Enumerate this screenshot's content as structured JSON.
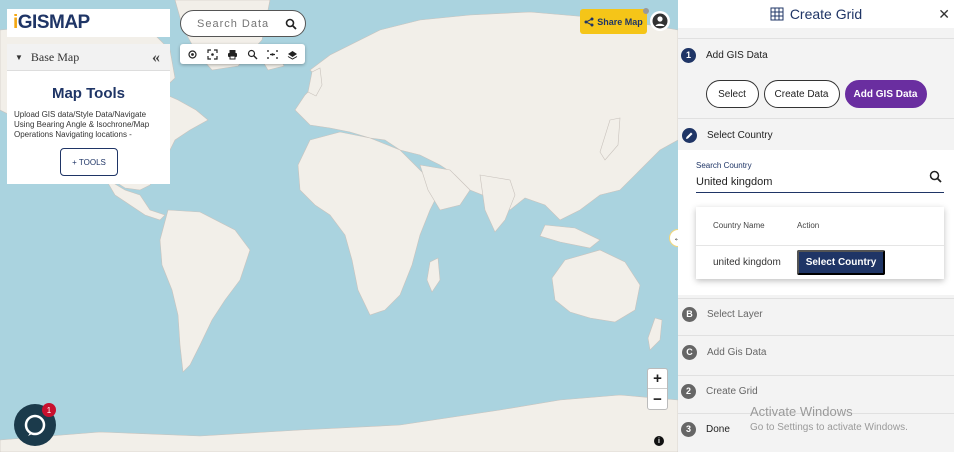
{
  "logo": {
    "prefix": "i",
    "text": "GISMAP"
  },
  "search": {
    "placeholder": "Search Data"
  },
  "basemap": {
    "label": "Base Map"
  },
  "tools": {
    "title": "Map Tools",
    "description": "Upload GIS data/Style Data/Navigate Using Bearing Angle & Isochrone/Map Operations Navigating locations -",
    "button_label": "+ TOOLS"
  },
  "share": {
    "label": "Share Map"
  },
  "zoom": {
    "in": "+",
    "out": "−"
  },
  "chat": {
    "badge": "1"
  },
  "panel": {
    "title": "Create Grid",
    "close": "✕",
    "steps": [
      {
        "marker": "1",
        "label": "Add GIS Data"
      },
      {
        "marker": "",
        "label": "Select Country"
      },
      {
        "marker": "B",
        "label": "Select Layer"
      },
      {
        "marker": "C",
        "label": "Add Gis Data"
      },
      {
        "marker": "2",
        "label": "Create Grid"
      },
      {
        "marker": "3",
        "label": "Done"
      }
    ],
    "data_buttons": [
      "Select",
      "Create Data",
      "Add GIS Data"
    ],
    "country_search": {
      "label": "Search Country",
      "value": "United kingdom"
    },
    "results": {
      "columns": [
        "Country Name",
        "Action"
      ],
      "rows": [
        {
          "name": "united kingdom",
          "action": "Select Country"
        }
      ]
    }
  },
  "watermark": {
    "line1": "Activate Windows",
    "line2": "Go to Settings to activate Windows."
  },
  "colors": {
    "water": "#aad3df",
    "land": "#f2efe9",
    "brand": "#1f3566",
    "accent": "#6a2ea0",
    "share": "#f5c518"
  }
}
